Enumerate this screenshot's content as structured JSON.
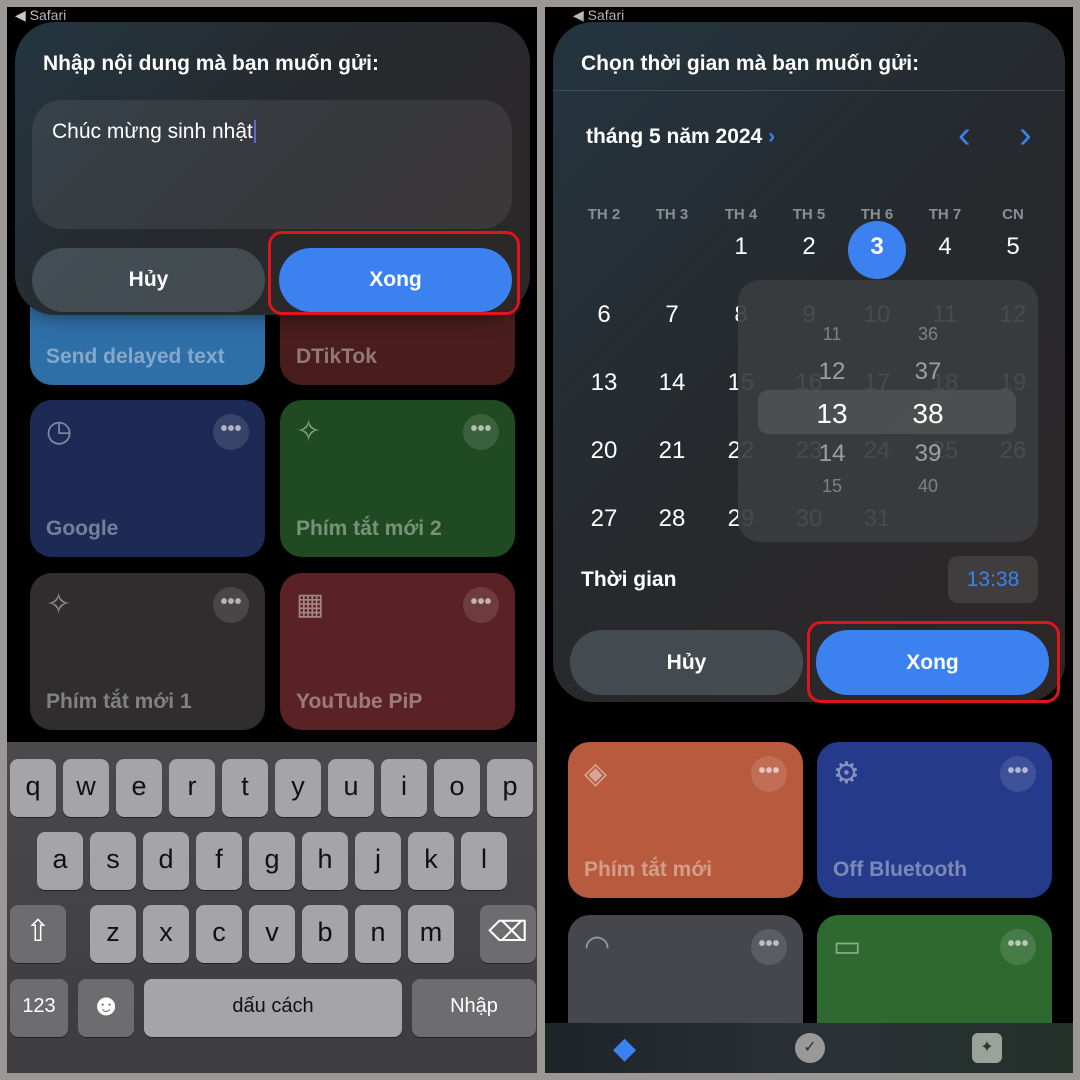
{
  "left": {
    "status": "◀ Safari",
    "dialog": {
      "title": "Nhập nội dung mà bạn muốn gửi:",
      "input_value": "Chúc mừng sinh nhật",
      "cancel": "Hủy",
      "done": "Xong"
    },
    "tiles": [
      {
        "label": "Send delayed text",
        "color": "#2f6fa8"
      },
      {
        "label": "DTikTok",
        "color": "#4a1d1d"
      },
      {
        "label": "Google",
        "color": "#1c2a55",
        "icon": "clock-icon"
      },
      {
        "label": "Phím tắt mới 2",
        "color": "#1f4a22",
        "icon": "magic-wand-icon"
      },
      {
        "label": "Phím tắt mới 1",
        "color": "#2f2d2d",
        "icon": "magic-wand-icon"
      },
      {
        "label": "YouTube PiP",
        "color": "#5a2224",
        "icon": "grid-icon"
      }
    ],
    "more": "•••",
    "keyboard": {
      "row1": [
        "q",
        "w",
        "e",
        "r",
        "t",
        "y",
        "u",
        "i",
        "o",
        "p"
      ],
      "row2": [
        "a",
        "s",
        "d",
        "f",
        "g",
        "h",
        "j",
        "k",
        "l"
      ],
      "row3": [
        "z",
        "x",
        "c",
        "v",
        "b",
        "n",
        "m"
      ],
      "shift": "⇧",
      "delete": "⌫",
      "numbers": "123",
      "emoji": "☻",
      "space": "dấu cách",
      "return": "Nhập"
    }
  },
  "right": {
    "status": "◀ Safari",
    "dialog": {
      "title": "Chọn thời gian mà bạn muốn gửi:",
      "month": "tháng 5 năm 2024",
      "month_chevron": "›",
      "prev": "‹",
      "next": "›",
      "weekdays": [
        "TH 2",
        "TH 3",
        "TH 4",
        "TH 5",
        "TH 6",
        "TH 7",
        "CN"
      ],
      "selected_day": 3,
      "picker": {
        "hours": [
          "11",
          "12",
          "13",
          "14",
          "15"
        ],
        "minutes": [
          "36",
          "37",
          "38",
          "39",
          "40"
        ],
        "selected_hour": "13",
        "selected_minute": "38"
      },
      "time_label": "Thời gian",
      "time_value": "13:38",
      "cancel": "Hủy",
      "done": "Xong"
    },
    "tiles": [
      {
        "label": "Phím tắt mới",
        "color": "#b85a3e",
        "icon": "layers-icon"
      },
      {
        "label": "Off Bluetooth",
        "color": "#253a8a",
        "icon": "gear-play-icon"
      },
      {
        "label": "",
        "color": "#45474d",
        "icon": "wifi-icon"
      },
      {
        "label": "",
        "color": "#2e6a30",
        "icon": "battery-icon"
      }
    ],
    "accent": "#3b82f0"
  }
}
